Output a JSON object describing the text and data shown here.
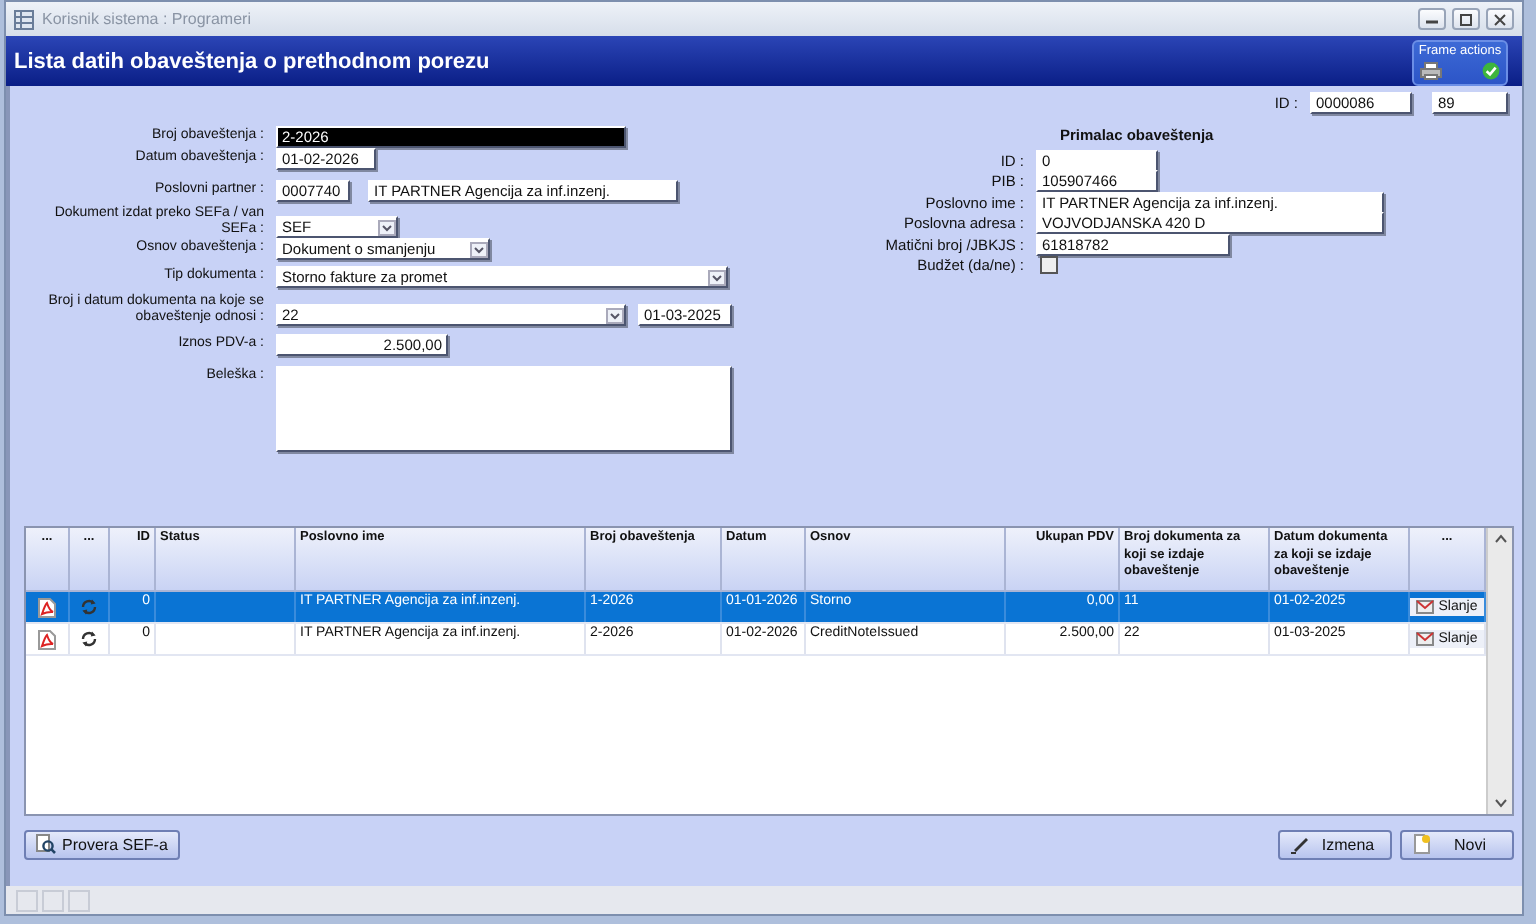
{
  "window": {
    "title": "Korisnik sistema : Programeri"
  },
  "header": {
    "title": "Lista datih obaveštenja o prethodnom porezu"
  },
  "frame_actions": {
    "title": "Frame actions"
  },
  "record_id": {
    "label": "ID :",
    "values": [
      "0000086",
      "89"
    ]
  },
  "form": [
    {
      "label": "Broj obaveštenja :",
      "fields": [
        {
          "kind": "text",
          "value": "2-2026",
          "focused": true
        }
      ]
    },
    {
      "label": "Datum obaveštenja :",
      "fields": [
        {
          "kind": "text",
          "value": "01-02-2026",
          "focused": false
        }
      ]
    },
    {
      "label": "Poslovni partner :",
      "fields": [
        {
          "kind": "text",
          "value": "0007740",
          "focused": false
        },
        {
          "kind": "text",
          "value": "IT PARTNER Agencija za inf.inzenj.",
          "focused": false
        }
      ]
    },
    {
      "label": "Dokument izdat preko SEFa / van SEFa :",
      "fields": [
        {
          "kind": "select",
          "value": "SEF",
          "focused": false
        }
      ]
    },
    {
      "label": "Osnov obaveštenja :",
      "fields": [
        {
          "kind": "select",
          "value": "Dokument o smanjenju",
          "focused": false
        }
      ]
    },
    {
      "label": "Tip dokumenta :",
      "fields": [
        {
          "kind": "select",
          "value": "Storno fakture za promet",
          "focused": false
        }
      ]
    },
    {
      "label": "Broj i datum dokumenta na koje se obaveštenje odnosi :",
      "fields": [
        {
          "kind": "select",
          "value": "22",
          "focused": false
        },
        {
          "kind": "text",
          "value": "01-03-2025",
          "focused": false
        }
      ]
    },
    {
      "label": "Iznos PDV-a :",
      "fields": [
        {
          "kind": "amount",
          "value": "2.500,00",
          "focused": false
        }
      ]
    },
    {
      "label": "Beleška :",
      "fields": [
        {
          "kind": "textarea",
          "focused": false
        }
      ]
    }
  ],
  "recipient": {
    "title": "Primalac obaveštenja",
    "rows": [
      {
        "label": "ID :",
        "kind": "text",
        "value": "0"
      },
      {
        "label": "PIB :",
        "kind": "text",
        "value": "105907466"
      },
      {
        "label": "Poslovno ime :",
        "kind": "text",
        "value": "IT PARTNER Agencija za inf.inzenj."
      },
      {
        "label": "Poslovna adresa :",
        "kind": "text",
        "value": "VOJVODJANSKA 420 D"
      },
      {
        "label": "Matični broj /JBKJS :",
        "kind": "text",
        "value": "61818782"
      },
      {
        "label": "Budžet (da/ne) :",
        "kind": "checkbox",
        "checked": false
      }
    ]
  },
  "table": {
    "columns": [
      "...",
      "...",
      "ID",
      "Status",
      "Poslovno ime",
      "Broj obaveštenja",
      "Datum",
      "Osnov",
      "Ukupan PDV",
      "Broj dokumenta za koji se izdaje obaveštenje",
      "Datum dokumenta za koji se izdaje obaveštenje",
      "..."
    ],
    "rows": [
      {
        "selected": true,
        "id": "0",
        "status": "",
        "name": "IT PARTNER Agencija za inf.inzenj.",
        "number": "1-2026",
        "date": "01-01-2026",
        "basis": "Storno",
        "vat": "0,00",
        "doc_number": "11",
        "doc_date": "01-02-2025",
        "action": "Slanje"
      },
      {
        "selected": false,
        "id": "0",
        "status": "",
        "name": "IT PARTNER Agencija za inf.inzenj.",
        "number": "2-2026",
        "date": "01-02-2026",
        "basis": "CreditNoteIssued",
        "vat": "2.500,00",
        "doc_number": "22",
        "doc_date": "01-03-2025",
        "action": "Slanje"
      }
    ]
  },
  "buttons": {
    "left": [
      {
        "label": "Provera SEF-a",
        "kind": "check"
      }
    ],
    "right": [
      {
        "label": "Izmena",
        "kind": "edit"
      },
      {
        "label": "Novi",
        "kind": "new"
      }
    ]
  }
}
